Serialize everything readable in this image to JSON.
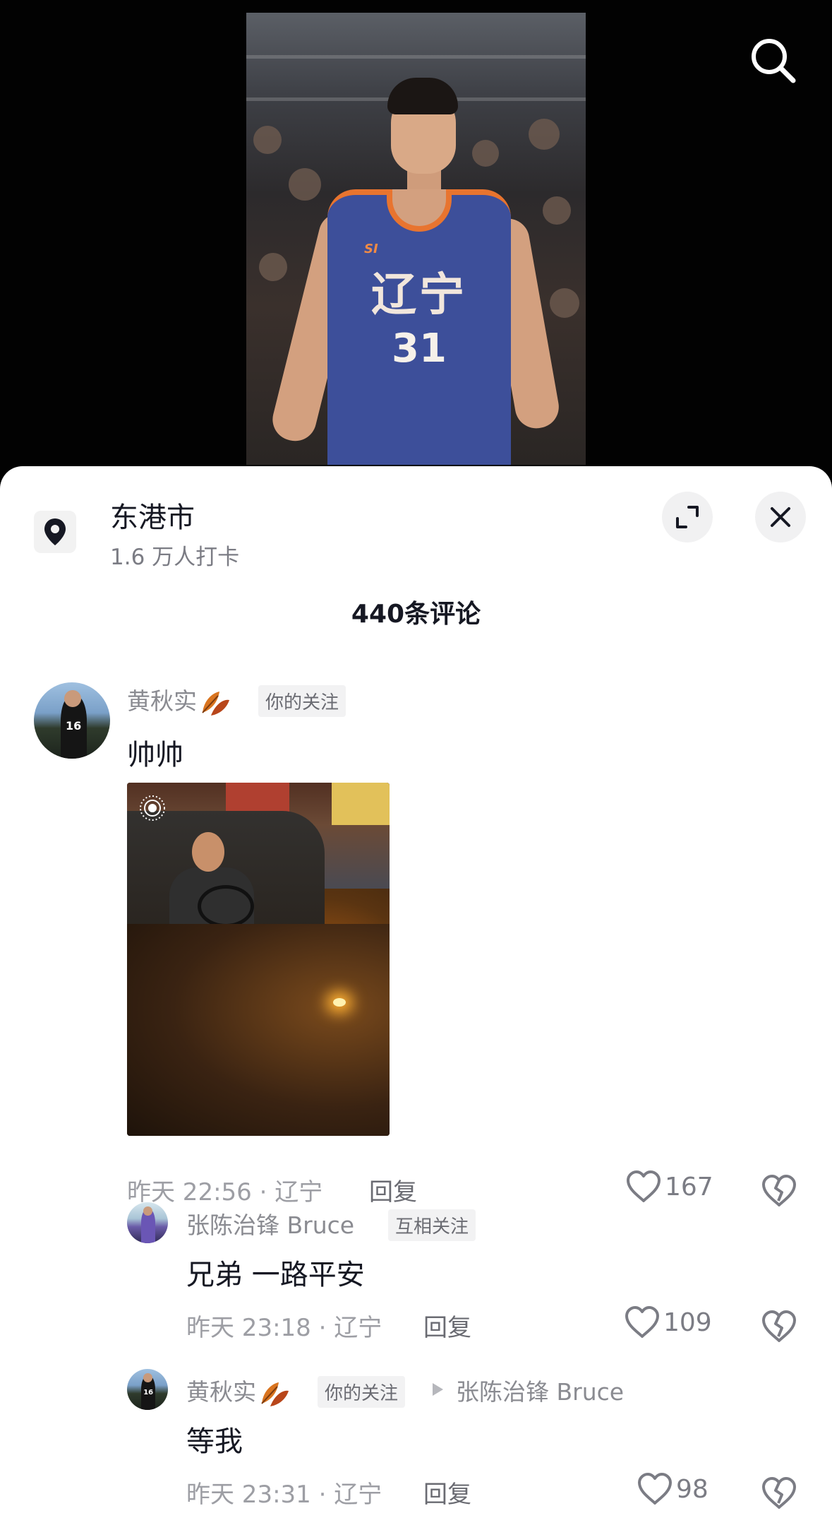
{
  "location": {
    "name": "东港市",
    "checkins": "1.6 万人打卡"
  },
  "comments_header": "440条评论",
  "video": {
    "jersey_text": "辽宁",
    "jersey_number": "31",
    "jersey_brand": "SI"
  },
  "comments": [
    {
      "user": "黄秋实",
      "tag": "你的关注",
      "text": "帅帅",
      "avatar_number": "16",
      "meta": "昨天 22:56 · 辽宁",
      "reply": "回复",
      "likes": "167"
    }
  ],
  "replies": [
    {
      "user": "张陈治锋 Bruce",
      "tag": "互相关注",
      "text": "兄弟 一路平安",
      "meta": "昨天 23:18 · 辽宁",
      "reply": "回复",
      "likes": "109"
    },
    {
      "user": "黄秋实",
      "tag": "你的关注",
      "reply_to": "张陈治锋 Bruce",
      "text": "等我",
      "avatar_number": "16",
      "meta": "昨天 23:31 · 辽宁",
      "reply": "回复",
      "likes": "98"
    }
  ],
  "icons": {
    "search": "search-icon",
    "location": "location-pin-icon",
    "expand": "expand-icon",
    "close": "close-icon",
    "like": "heart-icon",
    "dislike": "broken-heart-icon"
  },
  "colors": {
    "sheet_bg": "#ffffff",
    "video_bg": "#020202",
    "text_primary": "#161823",
    "text_secondary": "#8a8b91"
  }
}
